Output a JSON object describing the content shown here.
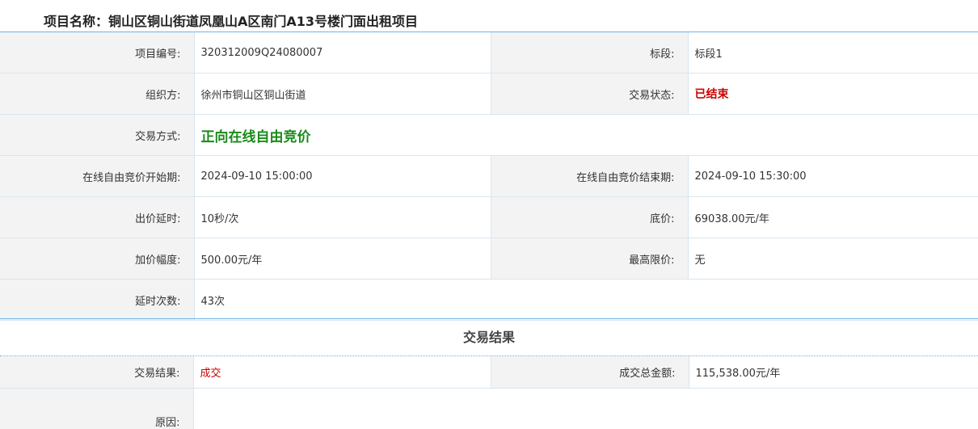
{
  "project": {
    "title_label": "项目名称：",
    "title_value": "铜山区铜山街道凤凰山A区南门A13号楼门面出租项目"
  },
  "fields": {
    "project_no": {
      "label": "项目编号:",
      "value": "320312009Q24080007"
    },
    "section": {
      "label": "标段:",
      "value": "标段1"
    },
    "organizer": {
      "label": "组织方:",
      "value": "徐州市铜山区铜山街道"
    },
    "trade_status": {
      "label": "交易状态:",
      "value": "已结束"
    },
    "trade_method": {
      "label": "交易方式:",
      "value": "正向在线自由竞价"
    },
    "start_time": {
      "label": "在线自由竞价开始期:",
      "value": "2024-09-10 15:00:00"
    },
    "end_time": {
      "label": "在线自由竞价结束期:",
      "value": "2024-09-10 15:30:00"
    },
    "bid_delay": {
      "label": "出价延时:",
      "value": "10秒/次"
    },
    "base_price": {
      "label": "底价:",
      "value": "69038.00元/年"
    },
    "increment": {
      "label": "加价幅度:",
      "value": "500.00元/年"
    },
    "max_price": {
      "label": "最高限价:",
      "value": "无"
    },
    "delay_count": {
      "label": "延时次数:",
      "value": "43次"
    }
  },
  "result_section": {
    "title": "交易结果",
    "result": {
      "label": "交易结果:",
      "value": "成交"
    },
    "total_amount": {
      "label": "成交总金额:",
      "value": "115,538.00元/年"
    },
    "reason": {
      "label": "原因:",
      "value": ""
    }
  },
  "colors": {
    "label_blue": "#1a73c0",
    "status_red": "#cc0000",
    "method_green": "#1a8a1a",
    "rule_blue": "#6fb3e6"
  }
}
